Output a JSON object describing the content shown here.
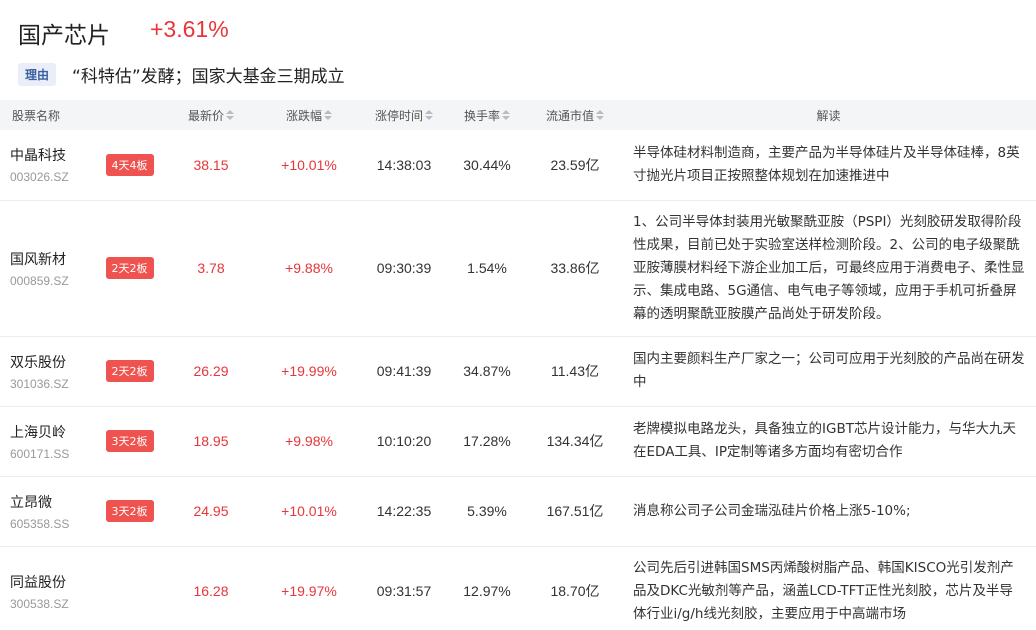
{
  "header": {
    "title": "国产芯片",
    "change_pct": "+3.61%",
    "reason_label": "理由",
    "reason_text": "“科特估”发酵；国家大基金三期成立"
  },
  "table": {
    "columns": {
      "name": "股票名称",
      "price": "最新价",
      "change": "涨跌幅",
      "limit_time": "涨停时间",
      "turnover": "换手率",
      "market_cap": "流通市值",
      "note": "解读"
    },
    "rows": [
      {
        "name": "中晶科技",
        "code": "003026.SZ",
        "badge": "4天4板",
        "price": "38.15",
        "change": "+10.01%",
        "time": "14:38:03",
        "turnover": "30.44%",
        "cap": "23.59亿",
        "note": "半导体硅材料制造商，主要产品为半导体硅片及半导体硅棒，8英寸抛光片项目正按照整体规划在加速推进中"
      },
      {
        "name": "国风新材",
        "code": "000859.SZ",
        "badge": "2天2板",
        "price": "3.78",
        "change": "+9.88%",
        "time": "09:30:39",
        "turnover": "1.54%",
        "cap": "33.86亿",
        "note": "1、公司半导体封装用光敏聚酰亚胺（PSPI）光刻胶研发取得阶段性成果，目前已处于实验室送样检测阶段。2、公司的电子级聚酰亚胺薄膜材料经下游企业加工后，可最终应用于消费电子、柔性显示、集成电路、5G通信、电气电子等领域，应用于手机可折叠屏幕的透明聚酰亚胺膜产品尚处于研发阶段。"
      },
      {
        "name": "双乐股份",
        "code": "301036.SZ",
        "badge": "2天2板",
        "price": "26.29",
        "change": "+19.99%",
        "time": "09:41:39",
        "turnover": "34.87%",
        "cap": "11.43亿",
        "note": "国内主要颜料生产厂家之一；公司可应用于光刻胶的产品尚在研发中"
      },
      {
        "name": "上海贝岭",
        "code": "600171.SS",
        "badge": "3天2板",
        "price": "18.95",
        "change": "+9.98%",
        "time": "10:10:20",
        "turnover": "17.28%",
        "cap": "134.34亿",
        "note": "老牌模拟电路龙头，具备独立的IGBT芯片设计能力，与华大九天在EDA工具、IP定制等诸多方面均有密切合作"
      },
      {
        "name": "立昂微",
        "code": "605358.SS",
        "badge": "3天2板",
        "price": "24.95",
        "change": "+10.01%",
        "time": "14:22:35",
        "turnover": "5.39%",
        "cap": "167.51亿",
        "note": "消息称公司子公司金瑞泓硅片价格上涨5-10%;"
      },
      {
        "name": "同益股份",
        "code": "300538.SZ",
        "badge": "",
        "price": "16.28",
        "change": "+19.97%",
        "time": "09:31:57",
        "turnover": "12.97%",
        "cap": "18.70亿",
        "note": "公司先后引进韩国SMS丙烯酸树脂产品、韩国KISCO光引发剂产品及DKC光敏剂等产品，涵盖LCD-TFT正性光刻胶，芯片及半导体行业i/g/h线光刻胶，主要应用于中高端市场"
      }
    ]
  },
  "colors": {
    "up": "#e8353a",
    "badge": "#ef5350",
    "header_bg": "#f4f5f7",
    "reason_tag_bg": "#e9eef8"
  }
}
